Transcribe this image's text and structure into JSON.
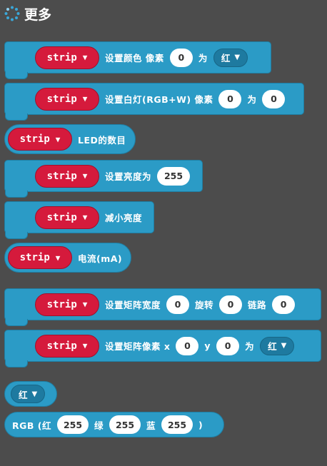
{
  "header": {
    "title": "更多",
    "icon": "spinner-icon"
  },
  "colors": {
    "bg": "#4c4c4c",
    "block": "#2b9bc6",
    "strip": "#d51a3c",
    "dropdown": "#1e7aa0"
  },
  "strip_label": "strip",
  "blocks": {
    "set_color": {
      "text1": "设置颜色 像素",
      "pixel": "0",
      "text2": "为",
      "color": "红"
    },
    "set_white": {
      "text1": "设置白灯(RGB+W) 像素",
      "pixel": "0",
      "text2": "为",
      "value": "0"
    },
    "led_count": {
      "text": "LED的数目"
    },
    "set_brightness": {
      "text": "设置亮度为",
      "value": "255"
    },
    "reduce_brightness": {
      "text": "减小亮度"
    },
    "current": {
      "text": "电流(mA)"
    },
    "matrix_width": {
      "text1": "设置矩阵宽度",
      "width": "0",
      "text2": "旋转",
      "rotate": "0",
      "text3": "链路",
      "chain": "0"
    },
    "matrix_pixel": {
      "text1": "设置矩阵像素 x",
      "x": "0",
      "text2": "y",
      "y": "0",
      "text3": "为",
      "color": "红"
    },
    "color_picker": {
      "color": "红"
    },
    "rgb": {
      "prefix": "RGB (红",
      "red": "255",
      "g_label": "绿",
      "green": "255",
      "b_label": "蓝",
      "blue": "255",
      "suffix": ")"
    }
  }
}
